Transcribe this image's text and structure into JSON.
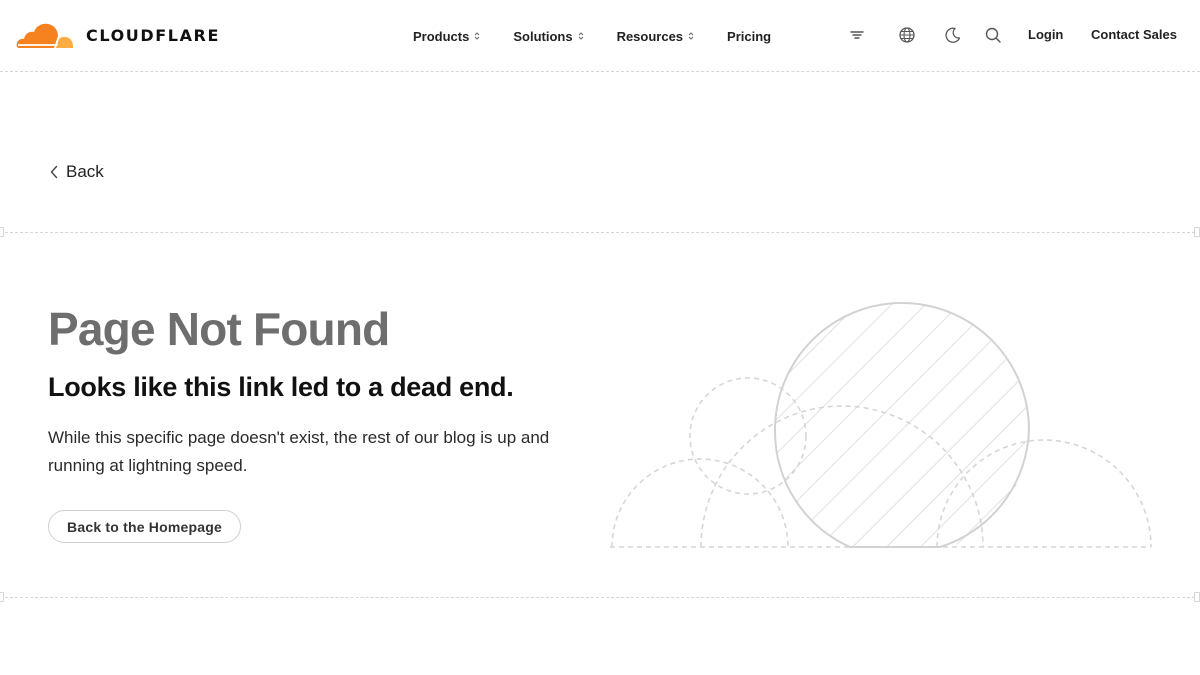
{
  "header": {
    "brand": "CLOUDFLARE",
    "brand_colors": {
      "orange": "#f6821f",
      "light_orange": "#fbad41"
    },
    "nav": [
      {
        "label": "Products",
        "has_menu": true
      },
      {
        "label": "Solutions",
        "has_menu": true
      },
      {
        "label": "Resources",
        "has_menu": true
      },
      {
        "label": "Pricing",
        "has_menu": false
      }
    ],
    "icons": [
      "filter-icon",
      "globe-icon",
      "moon-icon",
      "search-icon"
    ],
    "login_label": "Login",
    "contact_label": "Contact Sales"
  },
  "back": {
    "label": "Back"
  },
  "content": {
    "title": "Page Not Found",
    "subtitle": "Looks like this link led to a dead end.",
    "body": "While this specific page doesn't exist, the rest of our blog is up and running at lightning speed.",
    "button_label": "Back to the Homepage"
  }
}
